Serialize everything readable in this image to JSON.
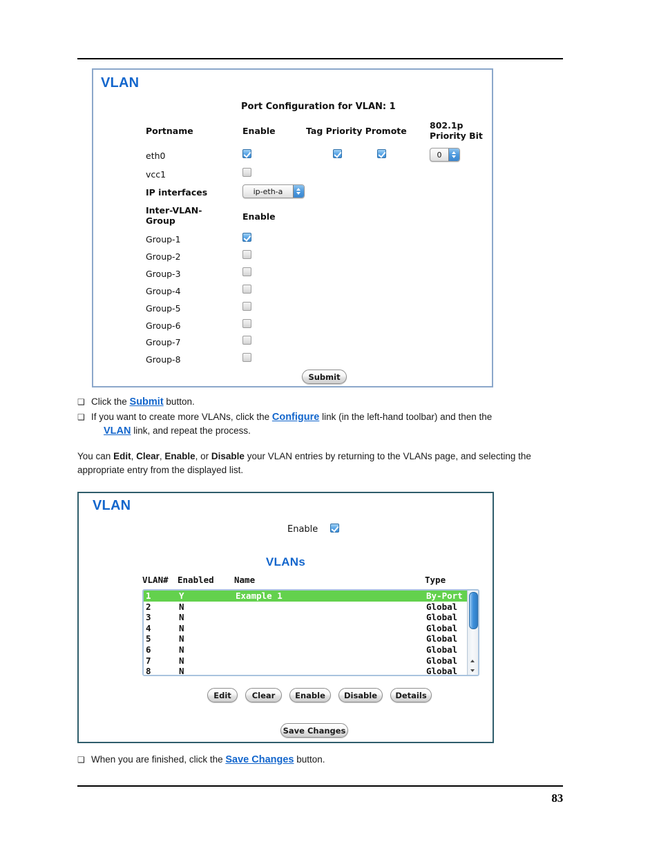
{
  "page": {
    "number": "83"
  },
  "panel_port_config": {
    "title": "VLAN",
    "section_title": "Port Configuration for VLAN: 1",
    "headers": {
      "portname": "Portname",
      "enable": "Enable",
      "tag": "Tag",
      "priority": "Priority",
      "promote": "Promote",
      "tag_priority_promote": "Tag Priority Promote",
      "priority_bit": "802.1p Priority Bit"
    },
    "ports": [
      {
        "name": "eth0",
        "enable_checked": true,
        "tag_checked": true,
        "promote_checked": true,
        "priority_bit_value": "0"
      },
      {
        "name": "vcc1",
        "enable_checked": false
      }
    ],
    "ip_interfaces": {
      "label": "IP interfaces",
      "value": "ip-eth-a"
    },
    "inter_vlan_group": {
      "label": "Inter-VLAN-Group",
      "enable_header": "Enable",
      "groups": [
        {
          "label": "Group-1",
          "checked": true
        },
        {
          "label": "Group-2",
          "checked": false
        },
        {
          "label": "Group-3",
          "checked": false
        },
        {
          "label": "Group-4",
          "checked": false
        },
        {
          "label": "Group-5",
          "checked": false
        },
        {
          "label": "Group-6",
          "checked": false
        },
        {
          "label": "Group-7",
          "checked": false
        },
        {
          "label": "Group-8",
          "checked": false
        }
      ]
    },
    "submit_label": "Submit"
  },
  "panel_vlan_list": {
    "title": "VLAN",
    "enable_label": "Enable",
    "enable_checked": true,
    "list_title": "VLANs",
    "columns": [
      "VLAN#",
      "Enabled",
      "Name",
      "Type"
    ],
    "rows": [
      {
        "num": "1",
        "enabled": "Y",
        "name": "Example 1",
        "type": "By-Port",
        "selected": true
      },
      {
        "num": "2",
        "enabled": "N",
        "name": "",
        "type": "Global",
        "selected": false
      },
      {
        "num": "3",
        "enabled": "N",
        "name": "",
        "type": "Global",
        "selected": false
      },
      {
        "num": "4",
        "enabled": "N",
        "name": "",
        "type": "Global",
        "selected": false
      },
      {
        "num": "5",
        "enabled": "N",
        "name": "",
        "type": "Global",
        "selected": false
      },
      {
        "num": "6",
        "enabled": "N",
        "name": "",
        "type": "Global",
        "selected": false
      },
      {
        "num": "7",
        "enabled": "N",
        "name": "",
        "type": "Global",
        "selected": false
      },
      {
        "num": "8",
        "enabled": "N",
        "name": "",
        "type": "Global",
        "selected": false
      }
    ],
    "buttons": {
      "edit": "Edit",
      "clear": "Clear",
      "enable": "Enable",
      "disable": "Disable",
      "details": "Details",
      "save_changes": "Save Changes"
    }
  },
  "prose": {
    "bullet_glyph": "❑",
    "bullet_submit": {
      "pre": "Click the ",
      "link": "Submit",
      "post": " button."
    },
    "bullet_configure": {
      "pre": "If you want to create more VLANs, click the ",
      "link1": "Configure",
      "mid": " link (in the left-hand toolbar) and then the",
      "link2": "VLAN",
      "post": " link, and repeat the process."
    },
    "paragraph_edit": {
      "pre": "You can ",
      "b1": "Edit",
      "s1": ", ",
      "b2": "Clear",
      "s2": ", ",
      "b3": "Enable",
      "s3": ", or ",
      "b4": "Disable",
      "post": " your VLAN entries by returning to the VLANs page, and select­ing the appropriate entry from the displayed list."
    },
    "bullet_save": {
      "pre": "When you are finished, click the ",
      "link": "Save Changes",
      "post": " button."
    }
  },
  "colors": {
    "link_blue": "#1366cc",
    "selected_row_green": "#63d14d",
    "panel1_border": "#8ba7ca",
    "panel2_border": "#2f5d6b",
    "checkbox_on": "#3f8fd8"
  }
}
